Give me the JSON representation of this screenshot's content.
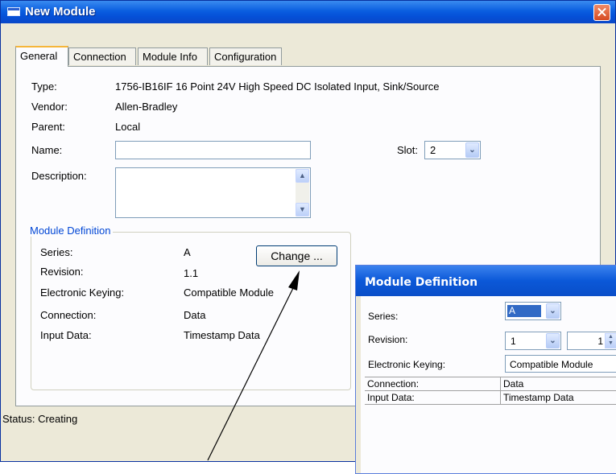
{
  "window": {
    "title": "New Module"
  },
  "tabs": [
    "General",
    "Connection",
    "Module Info",
    "Configuration"
  ],
  "general": {
    "type_label": "Type:",
    "type_value": "1756-IB16IF 16 Point 24V High Speed DC Isolated Input, Sink/Source",
    "vendor_label": "Vendor:",
    "vendor_value": "Allen-Bradley",
    "parent_label": "Parent:",
    "parent_value": "Local",
    "name_label": "Name:",
    "name_value": "",
    "description_label": "Description:",
    "description_value": "",
    "slot_label": "Slot:",
    "slot_value": "2"
  },
  "module_definition": {
    "title": "Module Definition",
    "series_label": "Series:",
    "series_value": "A",
    "revision_label": "Revision:",
    "revision_value": "1.1",
    "keying_label": "Electronic Keying:",
    "keying_value": "Compatible Module",
    "connection_label": "Connection:",
    "connection_value": "Data",
    "input_label": "Input Data:",
    "input_value": "Timestamp Data",
    "change_button": "Change ..."
  },
  "status": {
    "text": "Status:  Creating"
  },
  "md_dialog": {
    "title": "Module Definition",
    "series_label": "Series:",
    "series_value": "A",
    "revision_label": "Revision:",
    "revision_major": "1",
    "revision_minor": "1",
    "keying_label": "Electronic Keying:",
    "keying_value": "Compatible Module",
    "grid": [
      {
        "label": "Connection:",
        "value": "Data"
      },
      {
        "label": "Input Data:",
        "value": "Timestamp Data"
      }
    ]
  },
  "colors": {
    "title_bar": "#0a5ee0",
    "group_title": "#0046d5",
    "dialog_bg": "#ece9d8"
  },
  "icons": {
    "close": "close-icon",
    "window": "window-icon",
    "dropdown": "chevron-down-icon",
    "spinner": "spin-updown-icon"
  }
}
